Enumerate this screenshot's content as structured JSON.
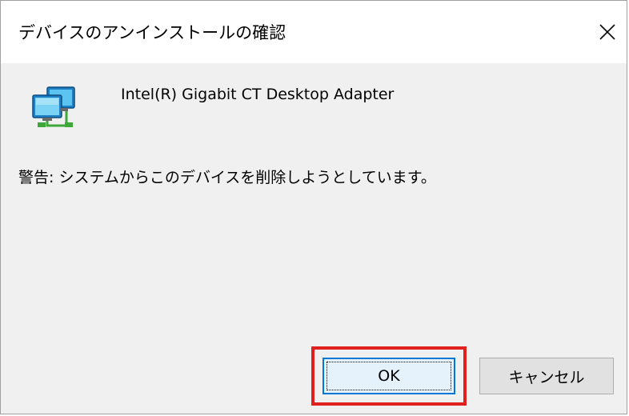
{
  "window": {
    "title": "デバイスのアンインストールの確認"
  },
  "device": {
    "icon": "network-adapter-icon",
    "name": "Intel(R) Gigabit CT Desktop Adapter"
  },
  "message": {
    "warning": "警告: システムからこのデバイスを削除しようとしています。"
  },
  "buttons": {
    "ok_label": "OK",
    "cancel_label": "キャンセル"
  },
  "colors": {
    "highlight": "#e0201c",
    "focus_border": "#0078d7",
    "dialog_background": "#f0f0f0"
  }
}
